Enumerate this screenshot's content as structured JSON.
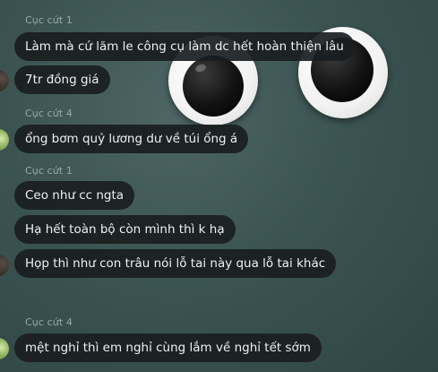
{
  "messages": [
    {
      "sender": "Cục cứt 1",
      "text": "Làm mà cứ lăm le công cụ làm dc hết hoàn thiện lâu"
    },
    {
      "text": "7tr đồng giá"
    },
    {
      "sender": "Cục cứt 4",
      "text": "ổng bơm quỷ lương dư về túi ổng á"
    },
    {
      "sender": "Cục cứt 1",
      "text": "Ceo như cc ngta"
    },
    {
      "text": "Hạ hết toàn bộ còn mình thì k hạ"
    },
    {
      "text": "Họp thì như con trâu nói lỗ tai này qua lỗ tai khác"
    },
    {
      "sender": "Cục cứt 4",
      "text": "mệt nghỉ thì em nghỉ cùng lắm về nghỉ tết sớm"
    }
  ]
}
